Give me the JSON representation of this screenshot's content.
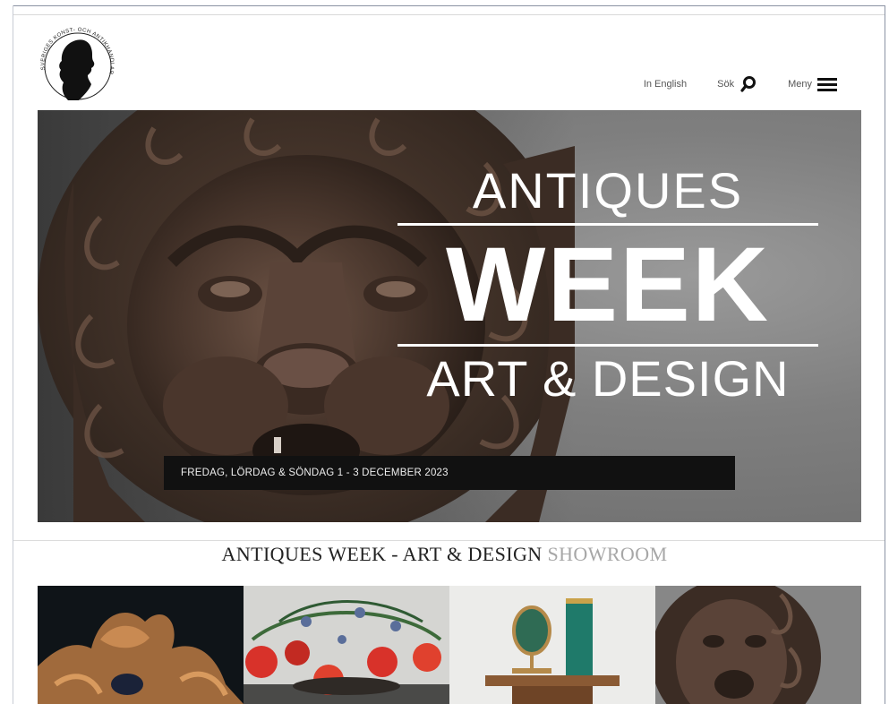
{
  "header": {
    "logo_text": "SVERIGES KONST- OCH ANTIKHANDLAREFÖRENING",
    "nav": {
      "english_label": "In English",
      "search_label": "Sök",
      "menu_label": "Meny"
    }
  },
  "hero": {
    "line1": "ANTIQUES",
    "line2": "WEEK",
    "line3": "ART & DESIGN",
    "banner": "FREDAG, LÖRDAG & SÖNDAG 1 - 3 DECEMBER 2023"
  },
  "section": {
    "title_main": "ANTIQUES WEEK - ART & DESIGN",
    "title_muted": "SHOWROOM"
  },
  "thumbnails": [
    {
      "subject": "gilded-rococo-frame"
    },
    {
      "subject": "red-tulip-bouquet"
    },
    {
      "subject": "vanity-mirror-and-green-vase"
    },
    {
      "subject": "bronze-lion-head"
    }
  ],
  "colors": {
    "hero_gray": "#8a8a8a",
    "banner_bg": "#111111",
    "text_dark": "#222222",
    "text_muted": "#a7a7a7"
  }
}
